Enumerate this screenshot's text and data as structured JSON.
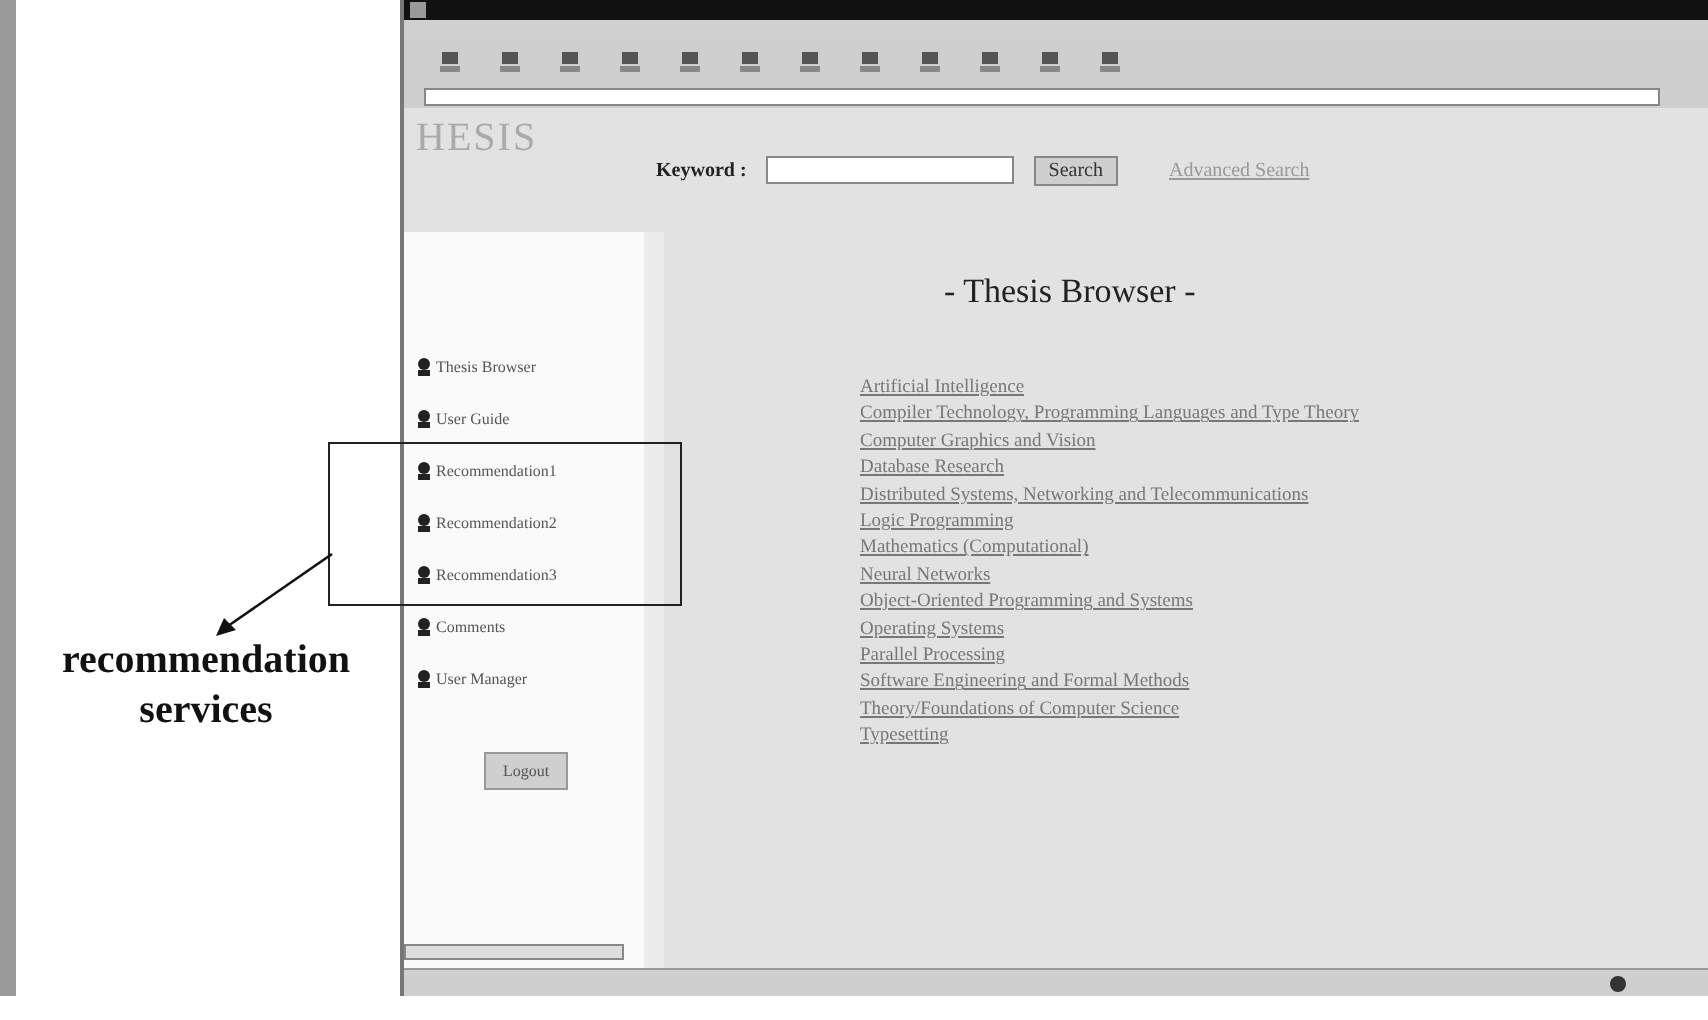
{
  "header": {
    "logo": "HESIS",
    "keyword_label": "Keyword :",
    "search_button": "Search",
    "advanced_link": "Advanced Search"
  },
  "sidebar": {
    "items": [
      {
        "label": "Thesis Browser"
      },
      {
        "label": "User Guide"
      },
      {
        "label": "Recommendation1"
      },
      {
        "label": "Recommendation2"
      },
      {
        "label": "Recommendation3"
      },
      {
        "label": "Comments"
      },
      {
        "label": "User Manager"
      }
    ],
    "logout_button": "Logout"
  },
  "main": {
    "title": "- Thesis Browser -",
    "categories": [
      "Artificial Intelligence",
      "Compiler Technology, Programming Languages and Type Theory",
      "Computer Graphics and Vision",
      "Database Research",
      "Distributed Systems, Networking and Telecommunications",
      "Logic Programming",
      "Mathematics (Computational)",
      "Neural Networks",
      "Object-Oriented Programming and Systems",
      "Operating Systems",
      "Parallel Processing",
      "Software Engineering and Formal Methods",
      "Theory/Foundations of Computer Science",
      "Typesetting"
    ]
  },
  "annotation": {
    "label": "recommendation services"
  }
}
